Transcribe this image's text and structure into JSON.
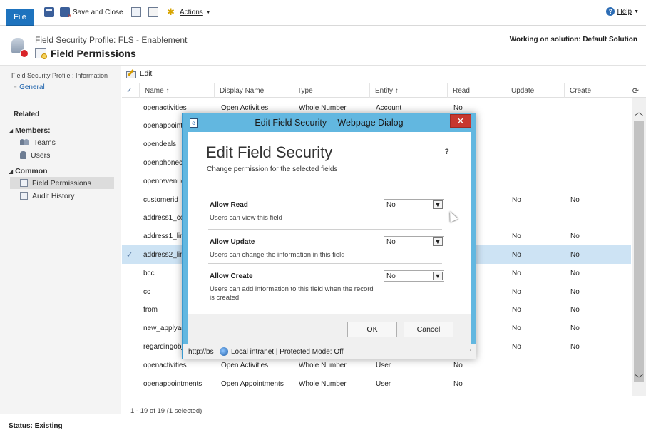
{
  "ribbon": {
    "file_label": "File",
    "save_close_label": "Save and Close",
    "actions_label": "Actions",
    "help_label": "Help"
  },
  "header": {
    "subtitle": "Field Security Profile: FLS - Enablement",
    "title": "Field Permissions",
    "solution": "Working on solution: Default Solution"
  },
  "leftnav": {
    "info_label": "Field Security Profile : Information",
    "general_label": "General",
    "related_label": "Related",
    "members_label": "Members:",
    "members_items": [
      "Teams",
      "Users"
    ],
    "common_label": "Common",
    "common_items": [
      "Field Permissions",
      "Audit History"
    ]
  },
  "grid": {
    "edit_label": "Edit",
    "columns": [
      "Name ↑",
      "Display Name",
      "Type",
      "Entity ↑",
      "Read",
      "Update",
      "Create"
    ],
    "rows": [
      {
        "name": "openactivities",
        "display": "Open Activities",
        "type": "Whole Number",
        "entity": "Account",
        "read": "No",
        "update": "",
        "create": "",
        "selected": false
      },
      {
        "name": "openappointments",
        "display": "",
        "type": "",
        "entity": "",
        "read": "",
        "update": "",
        "create": "",
        "selected": false
      },
      {
        "name": "opendeals",
        "display": "",
        "type": "",
        "entity": "",
        "read": "",
        "update": "",
        "create": "",
        "selected": false
      },
      {
        "name": "openphonecalls",
        "display": "",
        "type": "",
        "entity": "",
        "read": "",
        "update": "",
        "create": "",
        "selected": false
      },
      {
        "name": "openrevenue",
        "display": "",
        "type": "",
        "entity": "",
        "read": "",
        "update": "",
        "create": "",
        "selected": false
      },
      {
        "name": "customerid",
        "display": "",
        "type": "",
        "entity": "",
        "read": "",
        "update": "No",
        "create": "No",
        "selected": false
      },
      {
        "name": "address1_composite",
        "display": "",
        "type": "",
        "entity": "",
        "read": "",
        "update": "",
        "create": "",
        "selected": false
      },
      {
        "name": "address1_line1",
        "display": "",
        "type": "",
        "entity": "",
        "read": "",
        "update": "No",
        "create": "No",
        "selected": false
      },
      {
        "name": "address2_line1",
        "display": "",
        "type": "",
        "entity": "",
        "read": "",
        "update": "No",
        "create": "No",
        "selected": true
      },
      {
        "name": "bcc",
        "display": "",
        "type": "",
        "entity": "",
        "read": "",
        "update": "No",
        "create": "No",
        "selected": false
      },
      {
        "name": "cc",
        "display": "",
        "type": "",
        "entity": "",
        "read": "",
        "update": "No",
        "create": "No",
        "selected": false
      },
      {
        "name": "from",
        "display": "",
        "type": "",
        "entity": "",
        "read": "",
        "update": "No",
        "create": "No",
        "selected": false
      },
      {
        "name": "new_applyadhere",
        "display": "",
        "type": "",
        "entity": "",
        "read": "",
        "update": "No",
        "create": "No",
        "selected": false
      },
      {
        "name": "regardingobjectid",
        "display": "",
        "type": "",
        "entity": "",
        "read": "",
        "update": "No",
        "create": "No",
        "selected": false
      },
      {
        "name": "openactivities",
        "display": "Open Activities",
        "type": "Whole Number",
        "entity": "User",
        "read": "No",
        "update": "",
        "create": "",
        "selected": false
      },
      {
        "name": "openappointments",
        "display": "Open Appointments",
        "type": "Whole Number",
        "entity": "User",
        "read": "No",
        "update": "",
        "create": "",
        "selected": false
      }
    ],
    "footer": "1 - 19 of 19 (1 selected)"
  },
  "status": {
    "text": "Status: Existing"
  },
  "dialog": {
    "window_title": "Edit Field Security -- Webpage Dialog",
    "heading": "Edit Field Security",
    "help": "?",
    "subtitle": "Change permission for the selected fields",
    "permissions": [
      {
        "label": "Allow Read",
        "desc": "Users can view this field",
        "value": "No"
      },
      {
        "label": "Allow Update",
        "desc": "Users can change the information in this field",
        "value": "No"
      },
      {
        "label": "Allow Create",
        "desc": "Users can add information to this field when the record is created",
        "value": "No"
      }
    ],
    "ok_label": "OK",
    "cancel_label": "Cancel",
    "url_text": "http://bs",
    "zone_text": "Local intranet | Protected Mode: Off"
  }
}
